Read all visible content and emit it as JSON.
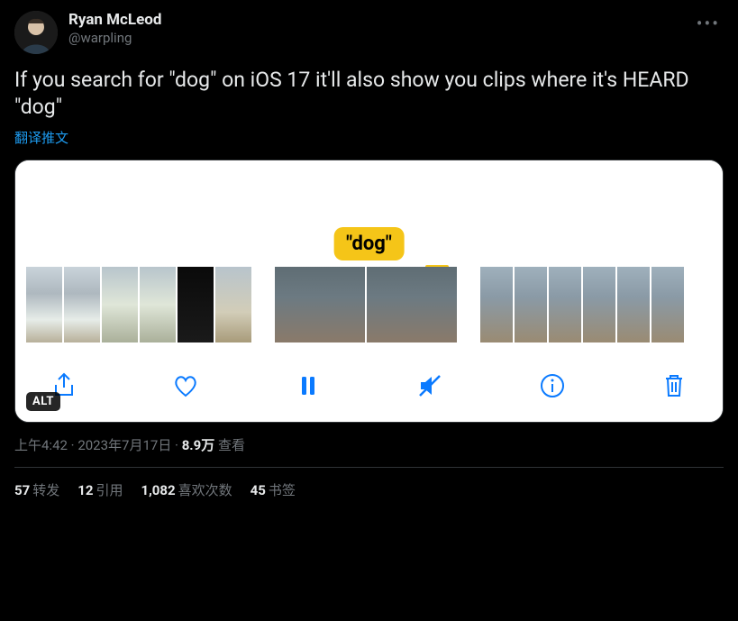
{
  "author": {
    "display_name": "Ryan McLeod",
    "handle": "@warpling"
  },
  "body": "If you search for \"dog\" on iOS 17 it'll also show you clips where it's HEARD \"dog\"",
  "translate_label": "翻译推文",
  "media": {
    "bubble": "\"dog\"",
    "alt_badge": "ALT"
  },
  "meta": {
    "time": "上午4:42",
    "sep1": " · ",
    "date": "2023年7月17日",
    "sep2": " · ",
    "views_count": "8.9万",
    "views_label": " 查看"
  },
  "stats": {
    "retweets": {
      "count": "57",
      "label": "转发"
    },
    "quotes": {
      "count": "12",
      "label": "引用"
    },
    "likes": {
      "count": "1,082",
      "label": "喜欢次数"
    },
    "bookmarks": {
      "count": "45",
      "label": "书签"
    }
  }
}
